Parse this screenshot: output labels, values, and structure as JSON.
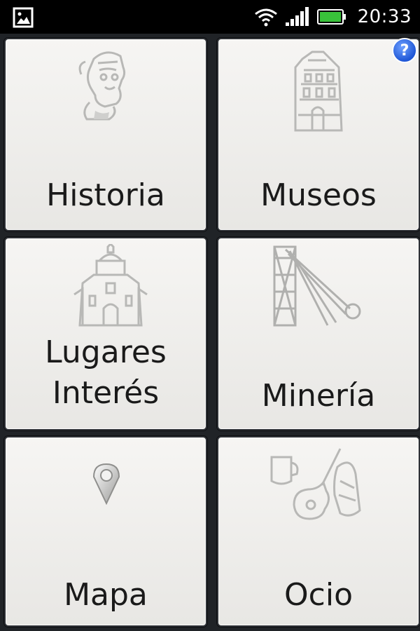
{
  "status_bar": {
    "time": "20:33",
    "icons": [
      "image-notification-icon",
      "wifi-icon",
      "signal-icon",
      "battery-icon"
    ]
  },
  "help_button": {
    "label": "?"
  },
  "tiles": [
    {
      "label_lines": [
        "Historia"
      ],
      "icon": "historical-figure-icon"
    },
    {
      "label_lines": [
        "Museos"
      ],
      "icon": "museum-building-icon"
    },
    {
      "label_lines": [
        "Lugares",
        "Interés"
      ],
      "icon": "church-icon"
    },
    {
      "label_lines": [
        "Minería"
      ],
      "icon": "mine-headframe-icon"
    },
    {
      "label_lines": [
        "Mapa"
      ],
      "icon": "map-pin-icon"
    },
    {
      "label_lines": [
        "Ocio"
      ],
      "icon": "leisure-guitar-icon"
    }
  ],
  "colors": {
    "background": "#202327",
    "tile": "#efeeec",
    "help_badge": "#2b63e0"
  }
}
